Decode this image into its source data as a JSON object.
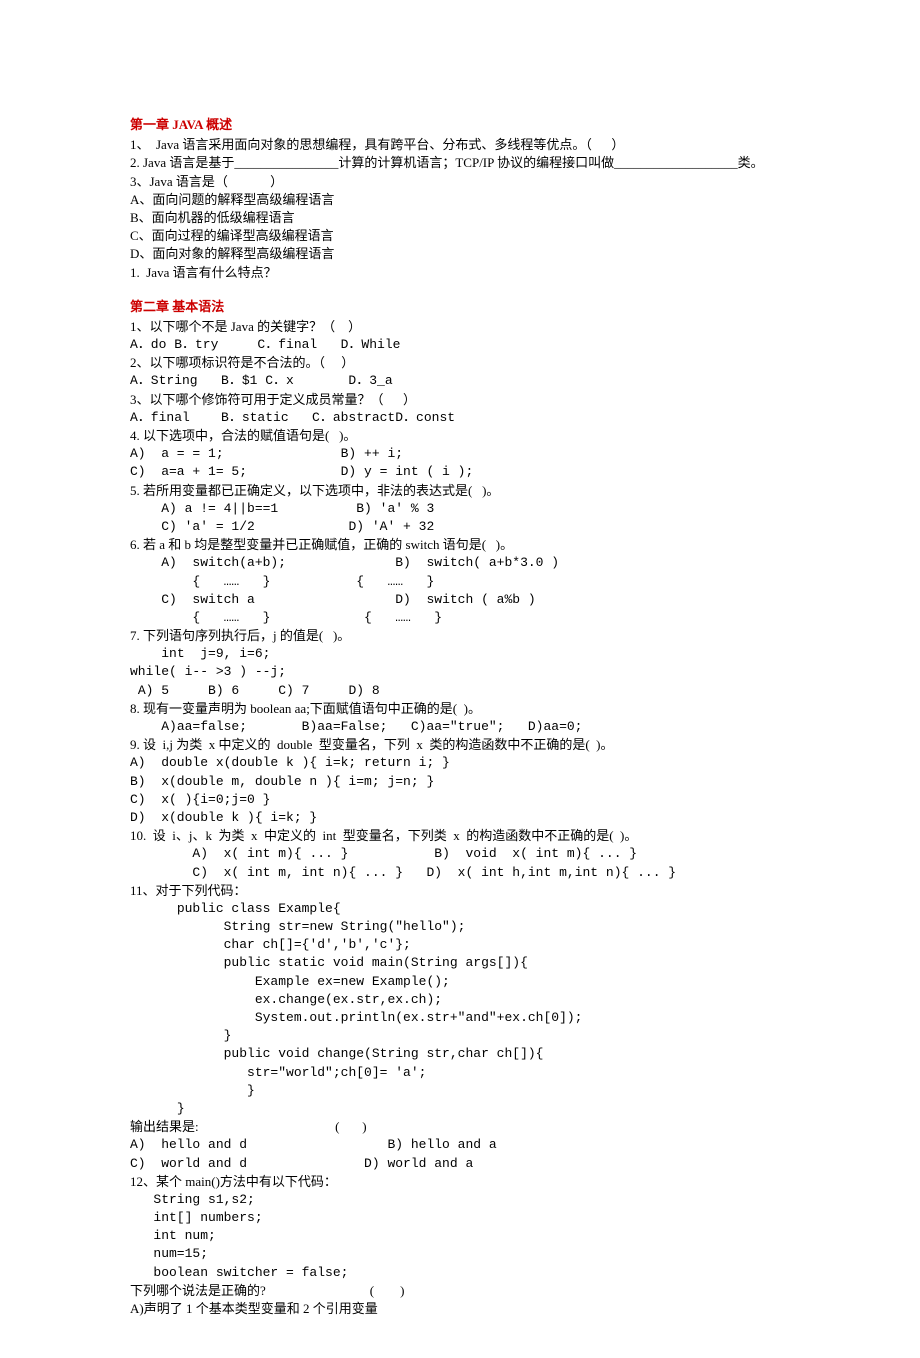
{
  "ch1": {
    "title": "第一章  JAVA 概述",
    "l1": "1、  Java 语言采用面向对象的思想编程，具有跨平台、分布式、多线程等优点。（      ）",
    "l2": "2. Java 语言是基于________________计算的计算机语言；TCP/IP 协议的编程接口叫做___________________类。",
    "l3": "3、Java 语言是（             ）",
    "l3a": "A、面向问题的解释型高级编程语言",
    "l3b": "B、面向机器的低级编程语言",
    "l3c": "C、面向过程的编译型高级编程语言",
    "l3d": "D、面向对象的解释型高级编程语言",
    "l4": "1.  Java 语言有什么特点？"
  },
  "ch2": {
    "title": "第二章 基本语法",
    "q1": "1、以下哪个不是 Java 的关键字？（    ）",
    "q1o": "A．do B．try     C．final   D．While",
    "q2": "2、以下哪项标识符是不合法的。（     ）",
    "q2o": "A．String   B．$1 C．x       D．3_a",
    "q3": "3、以下哪个修饰符可用于定义成员常量？（      ）",
    "q3o": "A．final    B．static   C．abstractD．const",
    "q4": "4. 以下选项中，合法的赋值语句是(   )。",
    "q4a": "A)  a = = 1;               B) ++ i;",
    "q4b": "C)  a=a + 1= 5;            D) y = int ( i );",
    "q5": "5. 若所用变量都已正确定义，以下选项中，非法的表达式是(   )。",
    "q5a": "    A) a != 4||b==1          B) 'a' % 3",
    "q5b": "    C) 'a' = 1/2            D) 'A' + 32",
    "q6": "6. 若 a 和 b 均是整型变量并已正确赋值，正确的 switch 语句是(   )。",
    "q6a": "    A)  switch(a+b);              B)  switch( a+b*3.0 )",
    "q6b": "        {   ……   }           {   ……   }",
    "q6c": "    C)  switch a                  D)  switch ( a%b )",
    "q6d": "        {   ……   }            {   ……   }",
    "q7": "7. 下列语句序列执行后，j 的值是(   )。",
    "q7a": "    int  j=9, i=6;",
    "q7b": "while( i-- >3 ) --j;",
    "q7c": " A) 5     B) 6     C) 7     D) 8",
    "q8": "8. 现有一变量声明为 boolean aa;下面赋值语句中正确的是(  )。",
    "q8a": "    A)aa=false;       B)aa=False;   C)aa=\"true\";   D)aa=0;",
    "q9": "9. 设  i,j 为类  x 中定义的  double  型变量名，下列  x  类的构造函数中不正确的是(  )。",
    "q9a": "A)  double x(double k ){ i=k; return i; }",
    "q9b": "B)  x(double m, double n ){ i=m; j=n; }",
    "q9c": "C)  x( ){i=0;j=0 }",
    "q9d": "D)  x(double k ){ i=k; }",
    "q10": "10.  设  i、j、k  为类  x  中定义的  int  型变量名，下列类  x  的构造函数中不正确的是(  )。",
    "q10a": "        A)  x( int m){ ... }           B)  void  x( int m){ ... }",
    "q10b": "        C)  x( int m, int n){ ... }   D)  x( int h,int m,int n){ ... }",
    "q11": "11、对于下列代码：",
    "q11a": "      public class Example{",
    "q11b": "            String str=new String(\"hello\");",
    "q11c": "            char ch[]={'d','b','c'};",
    "q11d": "            public static void main(String args[]){",
    "q11e": "                Example ex=new Example();",
    "q11f": "                ex.change(ex.str,ex.ch);",
    "q11g": "                System.out.println(ex.str+\"and\"+ex.ch[0]);",
    "q11h": "            }",
    "q11i": "            public void change(String str,char ch[]){",
    "q11j": "               str=\"world\";ch[0]= 'a';",
    "q11k": "               }",
    "q11l": "      }",
    "q11out": "输出结果是:                                          (       )",
    "q11o1": "A)  hello and d                  B) hello and a",
    "q11o2": "C)  world and d               D) world and a",
    "q12": "12、某个 main()方法中有以下代码：",
    "q12a": "   String s1,s2;",
    "q12b": "   int[] numbers;",
    "q12c": "   int num;",
    "q12d": "   num=15;",
    "q12e": "   boolean switcher = false;",
    "q12q": "下列哪个说法是正确的?                                (        )",
    "q12o": "A)声明了 1 个基本类型变量和 2 个引用变量"
  }
}
